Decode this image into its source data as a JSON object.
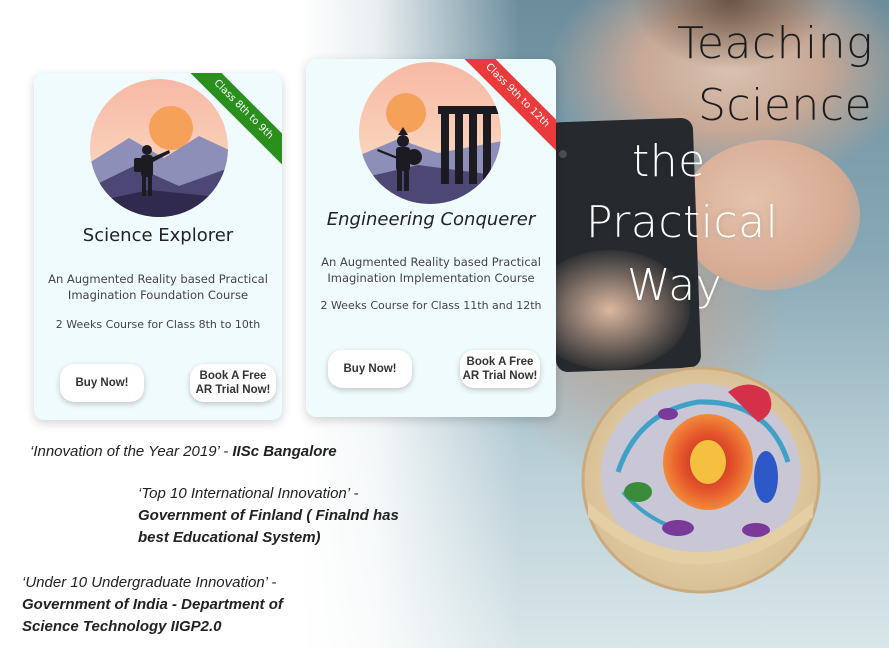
{
  "headline": {
    "line1": "Teaching",
    "line2": "Science",
    "line3": "the",
    "line4": "Practical",
    "line5": "Way"
  },
  "cards": [
    {
      "ribbon": "Class 8th to 9th",
      "ribbon_color": "#2a8f1c",
      "title": "Science Explorer",
      "description_line1": "An Augmented Reality based Practical",
      "description_line2": "Imagination Foundation Course",
      "subtitle": "2 Weeks Course for Class 8th to 10th",
      "buy_label": "Buy Now!",
      "trial_line1": "Book A Free",
      "trial_line2": "AR Trial Now!",
      "illustration": "explorer-illustration"
    },
    {
      "ribbon": "Class 9th to 12th",
      "ribbon_color": "#e93b3b",
      "title": "Engineering Conquerer",
      "description_line1": "An Augmented Reality based Practical",
      "description_line2": "Imagination Implementation Course",
      "subtitle": "2 Weeks Course for Class 11th and 12th",
      "buy_label": "Buy Now!",
      "trial_line1": "Book A Free",
      "trial_line2": "AR Trial Now!",
      "illustration": "warrior-illustration"
    }
  ],
  "awards": [
    {
      "quote": "‘Innovation of the Year 2019’",
      "sep": " - ",
      "source": "IISc Bangalore"
    },
    {
      "quote": "‘Top 10 International Innovation’",
      "sep": " -",
      "source_line1": "Government of Finland ( Finalnd has",
      "source_line2": "best Educational System)"
    },
    {
      "quote": "‘Under 10 Undergraduate Innovation’",
      "sep": " -",
      "source_line1": "Government of India - Department of",
      "source_line2": "Science Technology  IIGP2.0"
    }
  ]
}
